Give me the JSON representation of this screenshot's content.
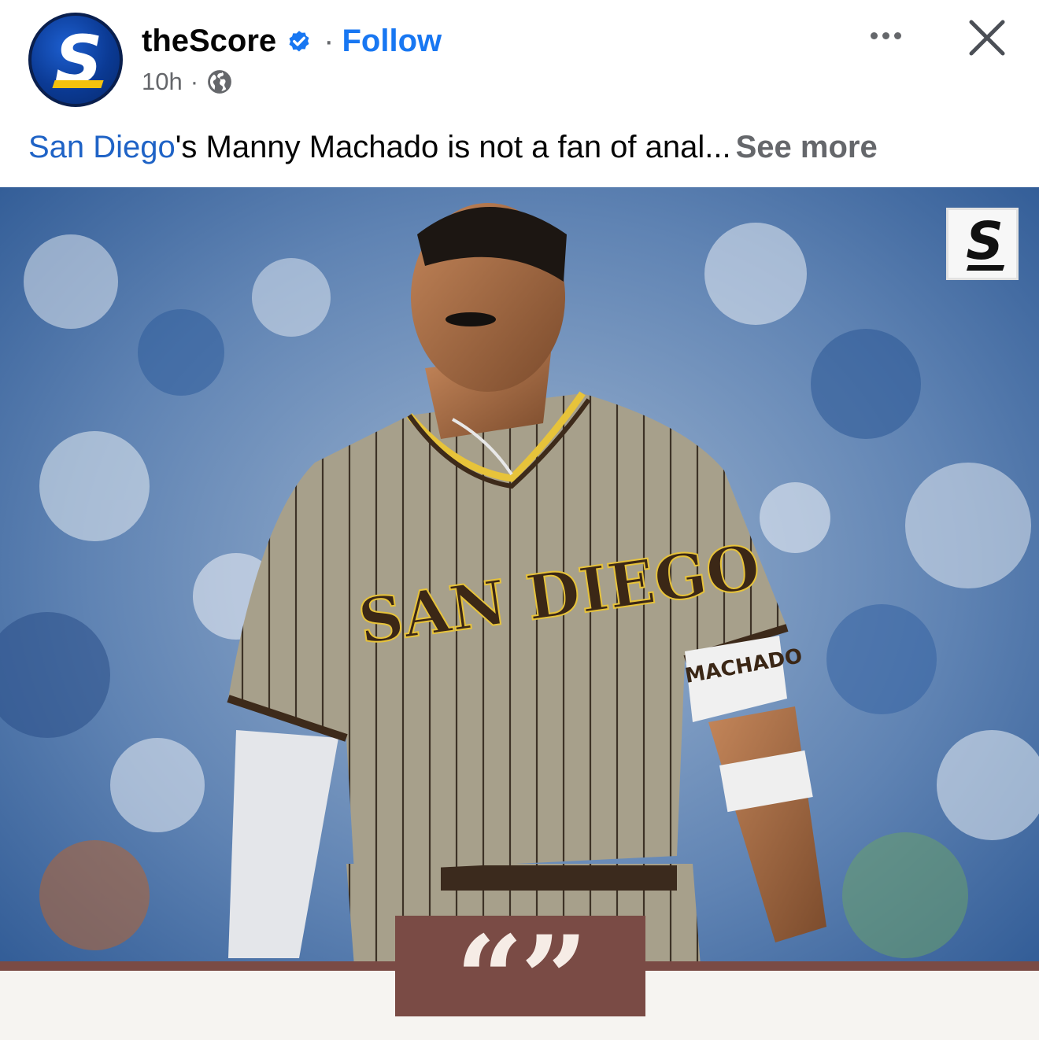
{
  "header": {
    "page_name": "theScore",
    "separator": "·",
    "follow_label": "Follow",
    "time": "10h",
    "meta_separator": "·",
    "avatar_letter": "S",
    "verified_icon": "verified-badge-icon",
    "privacy_icon": "globe-icon",
    "more_icon": "more-options-icon",
    "close_icon": "close-icon"
  },
  "caption": {
    "tag_text": "San Diego",
    "body_text": "'s Manny Machado is not a fan of anal...",
    "see_more_label": "See more"
  },
  "photo": {
    "watermark_letter": "S",
    "jersey_text": "SAN DIEGO",
    "armband_text": "MACHADO",
    "quote_glyph": "“”"
  },
  "colors": {
    "accent_blue": "#1877f2",
    "tag_blue": "#1f63c6",
    "secondary_text": "#65676b",
    "band_brown": "#7a4b45",
    "brand_yellow": "#f4c20d"
  }
}
